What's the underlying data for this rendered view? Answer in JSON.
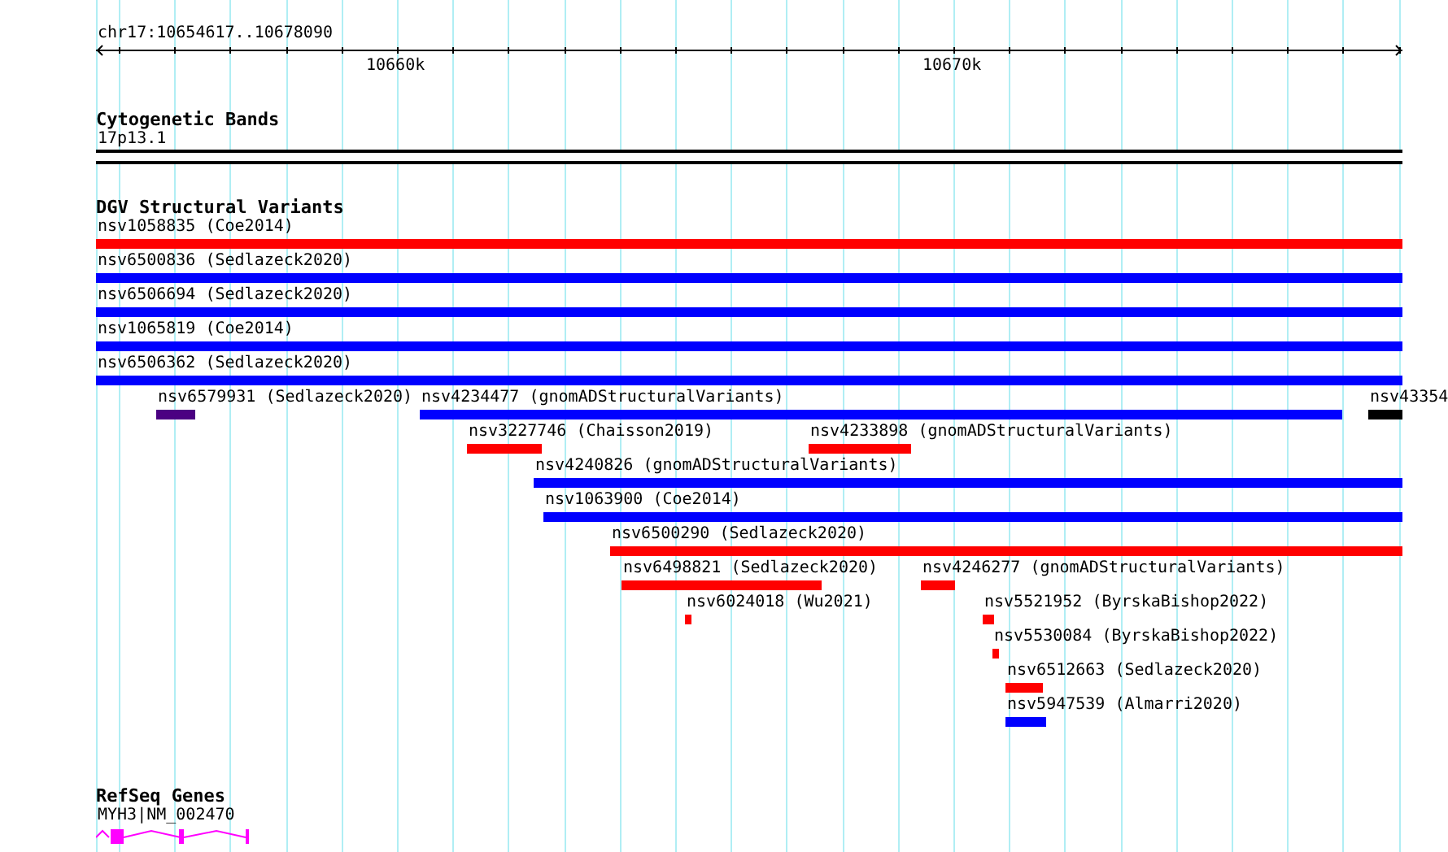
{
  "ruler": {
    "location": "chr17:10654617..10678090",
    "ticks": [
      "10660k",
      "10670k"
    ]
  },
  "tracks": [
    {
      "title": "Cytogenetic Bands",
      "kind": "bands",
      "features": [
        {
          "label": "17p13.1"
        }
      ]
    },
    {
      "title": "DGV Structural Variants",
      "kind": "variants",
      "features": [
        {
          "label": "nsv1058835 (Coe2014)",
          "color": "#ff0000"
        },
        {
          "label": "nsv6500836 (Sedlazeck2020)",
          "color": "#0000ff"
        },
        {
          "label": "nsv6506694 (Sedlazeck2020)",
          "color": "#0000ff"
        },
        {
          "label": "nsv1065819 (Coe2014)",
          "color": "#0000ff"
        },
        {
          "label": "nsv6506362 (Sedlazeck2020)",
          "color": "#0000ff"
        },
        {
          "label": "nsv6579931 (Sedlazeck2020)",
          "color": "#4b0082"
        },
        {
          "label": "nsv4234477 (gnomADStructuralVariants)",
          "color": "#0000ff"
        },
        {
          "label": "nsv43354",
          "color": "#000000"
        },
        {
          "label": "nsv3227746 (Chaisson2019)",
          "color": "#ff0000"
        },
        {
          "label": "nsv4233898 (gnomADStructuralVariants)",
          "color": "#ff0000"
        },
        {
          "label": "nsv4240826 (gnomADStructuralVariants)",
          "color": "#0000ff"
        },
        {
          "label": "nsv1063900 (Coe2014)",
          "color": "#0000ff"
        },
        {
          "label": "nsv6500290 (Sedlazeck2020)",
          "color": "#ff0000"
        },
        {
          "label": "nsv6498821 (Sedlazeck2020)",
          "color": "#ff0000"
        },
        {
          "label": "nsv4246277 (gnomADStructuralVariants)",
          "color": "#ff0000"
        },
        {
          "label": "nsv6024018 (Wu2021)",
          "color": "#ff0000"
        },
        {
          "label": "nsv5521952 (ByrskaBishop2022)",
          "color": "#ff0000"
        },
        {
          "label": "nsv5530084 (ByrskaBishop2022)",
          "color": "#ff0000"
        },
        {
          "label": "nsv6512663 (Sedlazeck2020)",
          "color": "#ff0000"
        },
        {
          "label": "nsv5947539 (Almarri2020)",
          "color": "#0000ff"
        }
      ]
    },
    {
      "title": "RefSeq Genes",
      "kind": "genes",
      "features": [
        {
          "label": "MYH3|NM_002470",
          "color": "#ff00ff"
        }
      ]
    }
  ]
}
